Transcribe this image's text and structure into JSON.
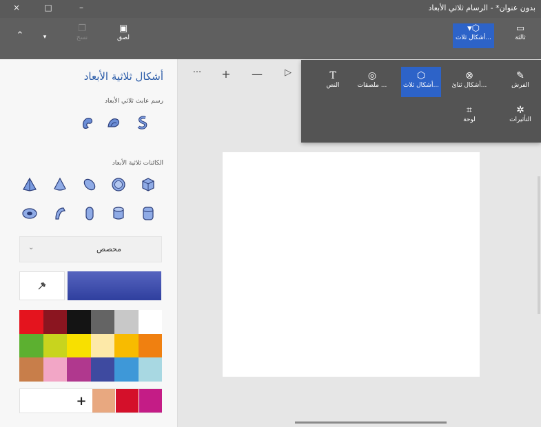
{
  "window": {
    "title": "بدون عنوان* - الرسام ثلاثي الأبعاد",
    "close_glyph": "×",
    "restore_glyph": "□",
    "minimize_glyph": "–"
  },
  "ribbon": {
    "undo_glyph": "⌃",
    "dropdown_glyph": "▾",
    "copy_label": "نسخ",
    "paste_label": "لصق",
    "shapes3d_label": "أشكال ثلاث...",
    "canvas_label": "ثالثة"
  },
  "panel": {
    "title": "أشكال ثلاثية الأبعاد",
    "doodle_section": "رسم عابث ثلاثي الأبعاد",
    "objects_section": "الكائنات ثلاثية الأبعاد",
    "dropdown_value": "محصص",
    "dropdown_chevron": "⌄",
    "plus_label": "+",
    "current_color": "#2f3f9e",
    "palette": [
      "#e4141e",
      "#8b1520",
      "#141414",
      "#646464",
      "#c8c8c8",
      "#ffffff",
      "#5cb030",
      "#c8d41e",
      "#f8e000",
      "#fde9a8",
      "#f8bb00",
      "#f08010",
      "#c87e4a",
      "#f2a6c6",
      "#b0388e",
      "#3e4aa0",
      "#3e98d8",
      "#a8d8e2"
    ],
    "custom_colors": [
      "#e8a880",
      "#d4102a",
      "#c41c86"
    ]
  },
  "canvas_toolbar": {
    "more": "···",
    "zoom_in": "+",
    "zoom_out": "—",
    "view": "▷"
  },
  "flyout": {
    "items": [
      {
        "label": "الفرش",
        "icon": "brush-icon"
      },
      {
        "label": "أشكال ثنائ...",
        "icon": "shapes-2d-icon"
      },
      {
        "label": "أشكال ثلاث...",
        "icon": "shapes-3d-icon"
      },
      {
        "label": "ملصقات ...",
        "icon": "stickers-icon"
      },
      {
        "label": "النص",
        "icon": "text-icon"
      },
      {
        "label": "التأثيرات",
        "icon": "effects-icon"
      },
      {
        "label": "لوحة",
        "icon": "canvas-icon"
      }
    ]
  }
}
